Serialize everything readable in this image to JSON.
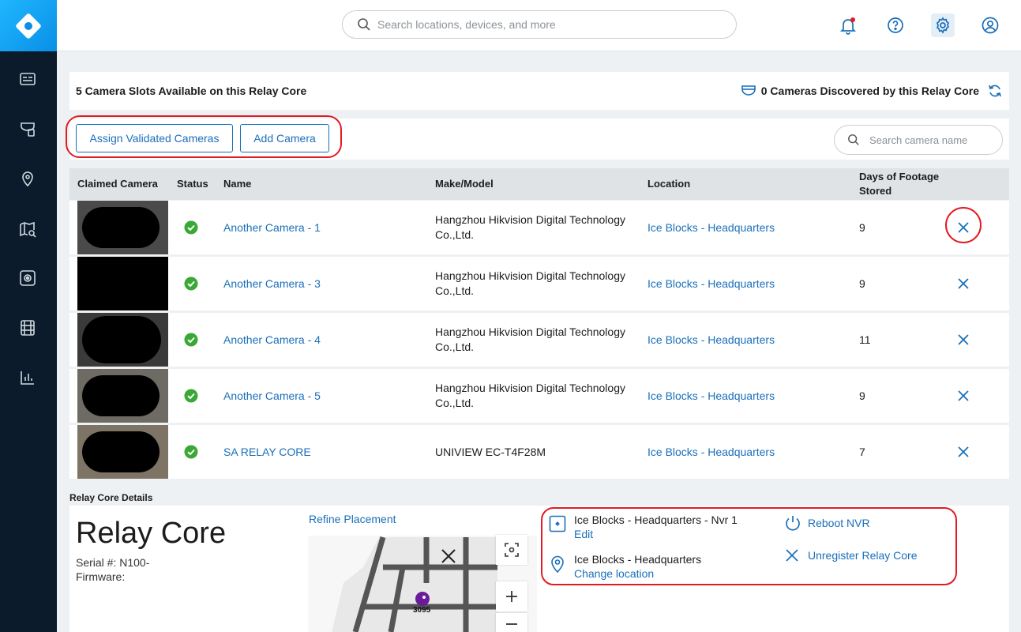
{
  "search": {
    "placeholder": "Search locations, devices, and more"
  },
  "slots": {
    "available_text": "5 Camera Slots Available on this Relay Core",
    "discovered_text": "0 Cameras Discovered by this Relay Core"
  },
  "actions": {
    "assign_label": "Assign Validated Cameras",
    "add_label": "Add Camera",
    "camera_search_placeholder": "Search camera name"
  },
  "table": {
    "headers": {
      "claimed": "Claimed Camera",
      "status": "Status",
      "name": "Name",
      "make": "Make/Model",
      "location": "Location",
      "days": "Days of Footage Stored"
    },
    "rows": [
      {
        "name": "Another Camera - 1",
        "make": "Hangzhou Hikvision Digital Technology Co.,Ltd.",
        "location": "Ice Blocks - Headquarters",
        "days": "9"
      },
      {
        "name": "Another Camera - 3",
        "make": "Hangzhou Hikvision Digital Technology Co.,Ltd.",
        "location": "Ice Blocks - Headquarters",
        "days": "9"
      },
      {
        "name": "Another Camera - 4",
        "make": "Hangzhou Hikvision Digital Technology Co.,Ltd.",
        "location": "Ice Blocks - Headquarters",
        "days": "11"
      },
      {
        "name": "Another Camera - 5",
        "make": "Hangzhou Hikvision Digital Technology Co.,Ltd.",
        "location": "Ice Blocks - Headquarters",
        "days": "9"
      },
      {
        "name": "SA RELAY CORE",
        "make": "UNIVIEW EC-T4F28M",
        "location": "Ice Blocks - Headquarters",
        "days": "7"
      }
    ]
  },
  "details": {
    "section_label": "Relay Core Details",
    "title": "Relay Core",
    "serial": "Serial #: N100-",
    "firmware": "Firmware:",
    "refine_label": "Refine Placement",
    "map_room_label": "3095",
    "nvr_name": "Ice Blocks - Headquarters - Nvr 1",
    "edit_label": "Edit",
    "location_name": "Ice Blocks - Headquarters",
    "change_location_label": "Change location",
    "reboot_label": "Reboot NVR",
    "unregister_label": "Unregister Relay Core"
  },
  "colors": {
    "accent": "#1a6fba",
    "success": "#3aa835",
    "highlight": "#e11b22",
    "sidebar": "#0b1b2b"
  }
}
